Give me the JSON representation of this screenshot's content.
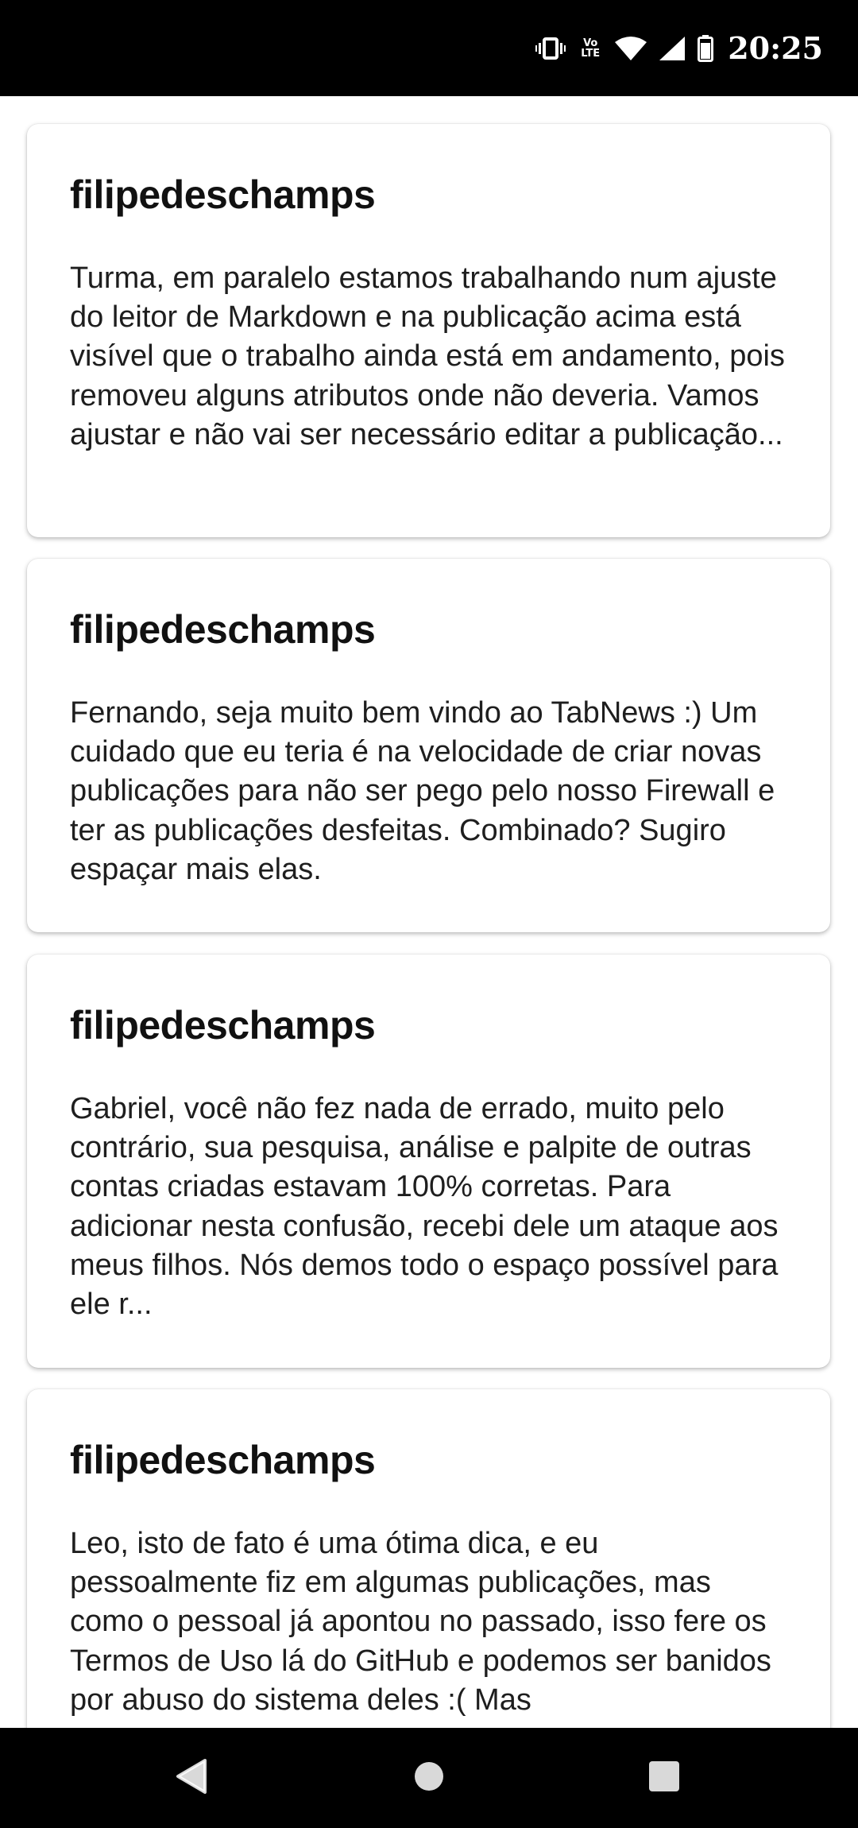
{
  "status_bar": {
    "time": "20:25",
    "volte_label_top": "Vo",
    "volte_label_bottom": "LTE",
    "icons": [
      "vibrate-icon",
      "volte-icon",
      "wifi-icon",
      "signal-icon",
      "battery-icon"
    ]
  },
  "comments": [
    {
      "author": "filipedeschamps",
      "body": "Turma, em paralelo estamos trabalhando num ajuste do leitor de Markdown e na publicação acima está visível que o trabalho ainda está em andamento, pois removeu alguns atributos onde não deveria. Vamos ajustar e não vai ser necessário editar a publicação..."
    },
    {
      "author": "filipedeschamps",
      "body": "Fernando, seja muito bem vindo ao TabNews :) Um cuidado que eu teria é na velocidade de criar novas publicações para não ser pego pelo nosso Firewall e ter as publicações desfeitas. Combinado? Sugiro espaçar mais elas."
    },
    {
      "author": "filipedeschamps",
      "body": "Gabriel, você não fez nada de errado, muito pelo contrário, sua pesquisa, análise e palpite de outras contas criadas estavam 100% corretas. Para adicionar nesta confusão, recebi dele um ataque aos meus filhos. Nós demos todo o espaço possível para ele r..."
    },
    {
      "author": "filipedeschamps",
      "body": "Leo, isto de fato é uma ótima dica, e eu pessoalmente fiz em algumas publicações, mas como o pessoal já apontou no passado, isso fere os Termos de Uso lá do GitHub e podemos ser banidos por abuso do sistema deles :( Mas"
    }
  ],
  "nav_bar": {
    "buttons": [
      "back-icon",
      "home-icon",
      "recents-icon"
    ]
  }
}
